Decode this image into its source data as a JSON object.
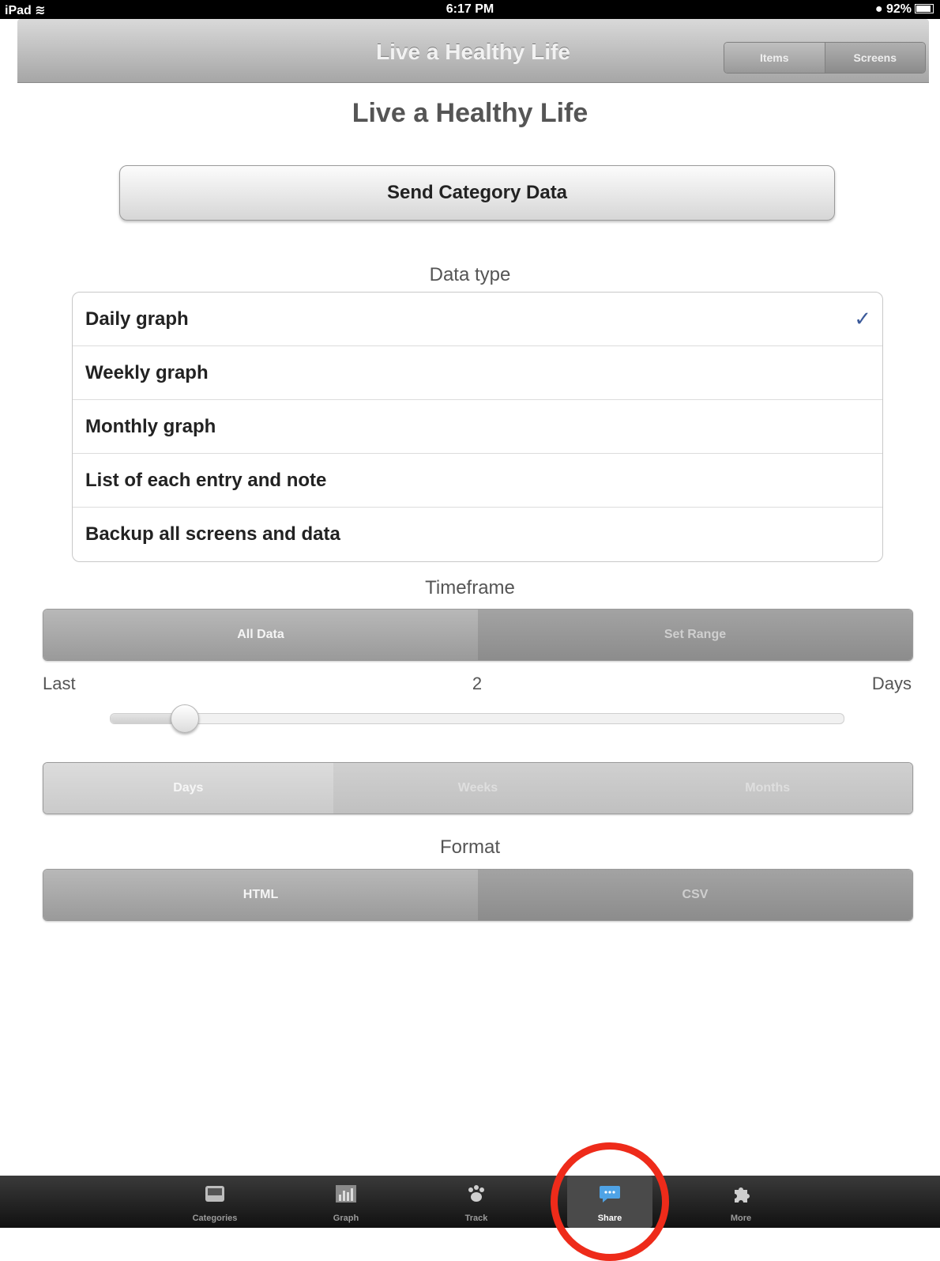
{
  "status_bar": {
    "device": "iPad",
    "time": "6:17 PM",
    "battery": "92%"
  },
  "nav": {
    "title": "Live a Healthy Life",
    "segments": [
      "Items",
      "Screens"
    ]
  },
  "page_title": "Live a Healthy Life",
  "send_button": "Send Category Data",
  "data_type": {
    "label": "Data type",
    "items": [
      {
        "label": "Daily graph",
        "selected": true
      },
      {
        "label": "Weekly graph"
      },
      {
        "label": "Monthly graph"
      },
      {
        "label": "List of each entry and note"
      },
      {
        "label": "Backup all screens and data"
      }
    ],
    "check": "✓"
  },
  "timeframe": {
    "label": "Timeframe",
    "segments": [
      "All Data",
      "Set Range"
    ],
    "selected_segment": "All Data"
  },
  "range": {
    "last_label": "Last",
    "value": "2",
    "unit_label": "Days",
    "slider_fraction": 0.1
  },
  "unit_segments": [
    "Days",
    "Weeks",
    "Months"
  ],
  "format": {
    "label": "Format",
    "segments": [
      "HTML",
      "CSV"
    ],
    "selected_segment": "HTML"
  },
  "tabs": [
    {
      "label": "Categories",
      "icon": "inbox-icon"
    },
    {
      "label": "Graph",
      "icon": "bar-graph-icon"
    },
    {
      "label": "Track",
      "icon": "paw-icon"
    },
    {
      "label": "Share",
      "icon": "speech-bubble-icon",
      "active": true
    },
    {
      "label": "More",
      "icon": "puzzle-icon"
    }
  ],
  "colors": {
    "highlight_ring": "#ee2b1a",
    "check": "#3b5a9a"
  }
}
